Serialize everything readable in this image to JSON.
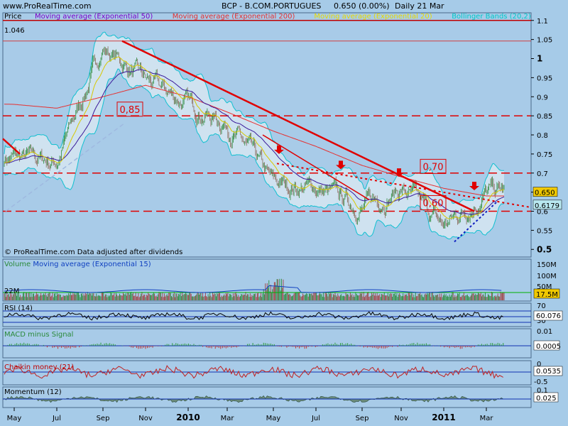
{
  "header": {
    "site": "www.ProRealTime.com",
    "title": "BCP - B.COM.PORTUGUES",
    "price_change": "0.650 (0.00%)",
    "period": "Daily  21 Mar"
  },
  "price_panel": {
    "legend": [
      "Price",
      "Moving average (Exponential 50)",
      "Moving average (Exponential 200)",
      "Moving average (Exponential 20)",
      "Bollinger Bands (20,2)"
    ],
    "legend_colors": [
      "#000000",
      "#7b00c8",
      "#e63030",
      "#e8d800",
      "#00c8c8"
    ],
    "high_label": "1.046",
    "y_labels": [
      "1.1",
      "1.05",
      "1",
      "0.95",
      "0.9",
      "0.85",
      "0.8",
      "0.75",
      "0.7",
      "0.65",
      "0.6",
      "0.55",
      "0.5"
    ],
    "last_price": "0.650",
    "last_ma": "0.6179",
    "annotations": [
      "0,85",
      "0,70",
      "0,60"
    ],
    "footer": "© ProRealTime.com  Data adjusted after dividends"
  },
  "volume_panel": {
    "legend": [
      "Volume",
      "Moving average (Exponential 15)"
    ],
    "left_label": "22M",
    "y_labels": [
      "150M",
      "100M",
      "50M"
    ],
    "value": "17.5M"
  },
  "rsi_panel": {
    "legend": "RSI (14)",
    "y_labels": [
      "70",
      "50",
      "30"
    ],
    "value": "60.076"
  },
  "macd_panel": {
    "legend": "MACD minus Signal",
    "y_labels": [
      "0.01",
      "0"
    ],
    "value": "0.0005"
  },
  "chaikin_panel": {
    "legend": "Chaikin money (21)",
    "y_labels": [
      "0",
      "-0.5"
    ],
    "value": "0.0535"
  },
  "momentum_panel": {
    "legend": "Momentum (12)",
    "y_labels": [
      "0.1"
    ],
    "value": "0.025"
  },
  "x_labels": [
    "May",
    "Jul",
    "Sep",
    "Nov",
    "2010",
    "Mar",
    "May",
    "Jul",
    "Sep",
    "Nov",
    "2011",
    "Mar"
  ],
  "chart_data": {
    "type": "line",
    "title": "BCP - B.COM.PORTUGUES",
    "x": [
      "May",
      "Jul",
      "Sep",
      "Nov",
      "2010",
      "Mar",
      "May",
      "Jul",
      "Sep",
      "Nov",
      "2011",
      "Mar"
    ],
    "series": [
      {
        "name": "Price",
        "values": [
          0.74,
          0.73,
          1.03,
          0.94,
          0.88,
          0.83,
          0.67,
          0.66,
          0.61,
          0.66,
          0.56,
          0.65
        ]
      },
      {
        "name": "Moving average (Exponential 200)",
        "values": [
          0.88,
          0.87,
          0.9,
          0.93,
          0.9,
          0.86,
          0.81,
          0.77,
          0.72,
          0.69,
          0.66,
          0.64
        ]
      }
    ],
    "ylim": [
      0.48,
      1.12
    ],
    "horizontal_levels": [
      1.1,
      1.046,
      0.85,
      0.7,
      0.6
    ],
    "grid": false
  }
}
